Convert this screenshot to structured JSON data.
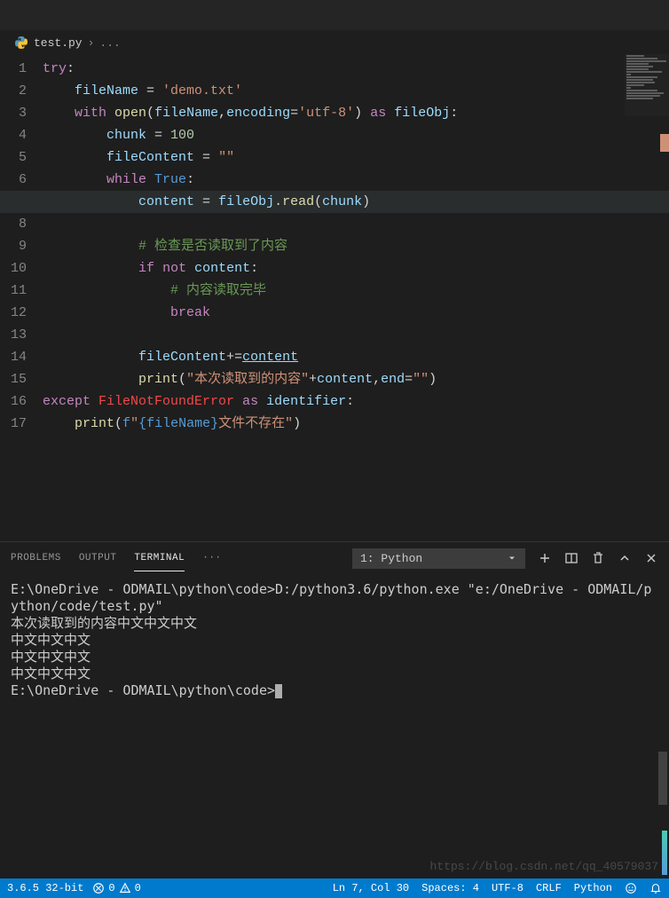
{
  "breadcrumb": {
    "file": "test.py",
    "sep": "›",
    "symbol": "..."
  },
  "code": {
    "lines": [
      "1",
      "2",
      "3",
      "4",
      "5",
      "6",
      "7",
      "8",
      "9",
      "10",
      "11",
      "12",
      "13",
      "14",
      "15",
      "16",
      "17"
    ],
    "l1": {
      "kw": "try",
      "colon": ":"
    },
    "l2": {
      "var": "fileName",
      "eq": " = ",
      "str": "'demo.txt'"
    },
    "l3": {
      "kw": "with",
      "sp": " ",
      "fn": "open",
      "lp": "(",
      "a1": "fileName",
      "c": ",",
      "a2": "encoding",
      "eq": "=",
      "s": "'utf-8'",
      "rp": ")",
      "sp2": " ",
      "as": "as",
      "sp3": " ",
      "obj": "fileObj",
      "col": ":"
    },
    "l4": {
      "var": "chunk",
      "eq": " = ",
      "num": "100"
    },
    "l5": {
      "var": "fileContent",
      "eq": " = ",
      "str": "\"\""
    },
    "l6": {
      "kw": "while",
      "sp": " ",
      "val": "True",
      "col": ":"
    },
    "l7": {
      "var": "content",
      "eq": " = ",
      "obj": "fileObj",
      "dot": ".",
      "fn": "read",
      "lp": "(",
      "arg": "chunk",
      "rp": ")"
    },
    "l9": {
      "cmt": "# 检查是否读取到了内容"
    },
    "l10": {
      "kw": "if",
      "sp": " ",
      "not": "not",
      "sp2": " ",
      "var": "content",
      "col": ":"
    },
    "l11": {
      "cmt": "# 内容读取完毕"
    },
    "l12": {
      "kw": "break"
    },
    "l14": {
      "var": "fileContent",
      "op": "+=",
      "link": "content"
    },
    "l15": {
      "fn": "print",
      "lp": "(",
      "str": "\"本次读取到的内容\"",
      "plus": "+",
      "var": "content",
      "c": ",",
      "kw": "end",
      "eq": "=",
      "s2": "\"\"",
      "rp": ")"
    },
    "l16": {
      "kw": "except",
      "sp": " ",
      "err": "FileNotFoundError",
      "sp2": " ",
      "as": "as",
      "sp3": " ",
      "id": "identifier",
      "col": ":"
    },
    "l17": {
      "fn": "print",
      "lp": "(",
      "f": "f",
      "q": "\"",
      "br1": "{fileName}",
      "str": "文件不存在",
      "q2": "\"",
      "rp": ")"
    }
  },
  "panel": {
    "tabs": {
      "problems": "PROBLEMS",
      "output": "OUTPUT",
      "terminal": "TERMINAL"
    },
    "more": "···",
    "select": {
      "label": "1: Python"
    }
  },
  "terminal": {
    "line1": "E:\\OneDrive - ODMAIL\\python\\code>D:/python3.6/python.exe \"e:/OneDrive - ODMAIL/python/code/test.py\"",
    "line2": "本次读取到的内容中文中文中文",
    "line3": "中文中文中文",
    "line4": "中文中文中文",
    "line5": "中文中文中文",
    "prompt": "E:\\OneDrive - ODMAIL\\python\\code>"
  },
  "statusbar": {
    "pyver": "3.6.5 32-bit",
    "err": "0",
    "warn": "0",
    "pos": "Ln 7, Col 30",
    "spaces": "Spaces: 4",
    "enc": "UTF-8",
    "eol": "CRLF",
    "lang": "Python"
  },
  "watermark": "https://blog.csdn.net/qq_40579037"
}
